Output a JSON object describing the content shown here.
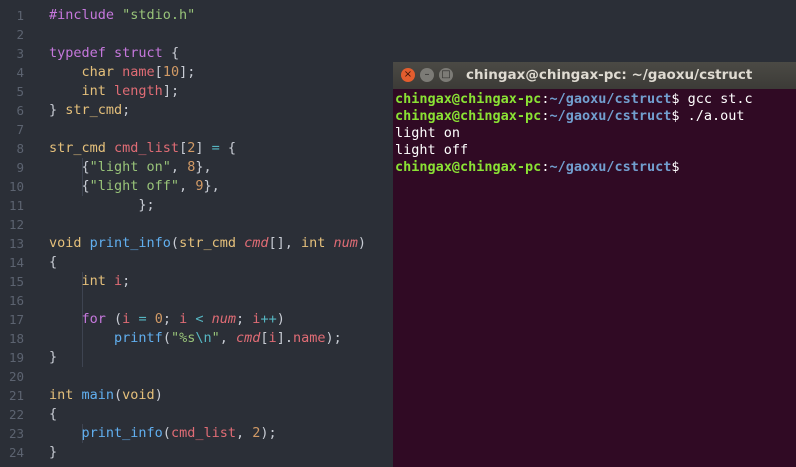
{
  "editor": {
    "lines": [
      {
        "n": "1",
        "t": [
          [
            "pp",
            "#include "
          ],
          [
            "st",
            "\"stdio.h\""
          ]
        ]
      },
      {
        "n": "2",
        "t": []
      },
      {
        "n": "3",
        "t": [
          [
            "kw",
            "typedef "
          ],
          [
            "kw",
            "struct "
          ],
          [
            "",
            "{"
          ]
        ]
      },
      {
        "n": "4",
        "t": [
          [
            "",
            "    "
          ],
          [
            "ty",
            "char "
          ],
          [
            "va",
            "name"
          ],
          [
            "",
            "["
          ],
          [
            "nu",
            "10"
          ],
          [
            "",
            "];"
          ]
        ]
      },
      {
        "n": "5",
        "t": [
          [
            "",
            "    "
          ],
          [
            "ty",
            "int "
          ],
          [
            "va",
            "length"
          ],
          [
            "",
            "];"
          ]
        ]
      },
      {
        "n": "6",
        "t": [
          [
            "",
            "} "
          ],
          [
            "ty",
            "str_cmd"
          ],
          [
            "",
            ";"
          ]
        ]
      },
      {
        "n": "7",
        "t": []
      },
      {
        "n": "8",
        "t": [
          [
            "ty",
            "str_cmd "
          ],
          [
            "va",
            "cmd_list"
          ],
          [
            "",
            "["
          ],
          [
            "nu",
            "2"
          ],
          [
            "",
            "] "
          ],
          [
            "op",
            "= "
          ],
          [
            "",
            "{"
          ]
        ]
      },
      {
        "n": "9",
        "t": [
          [
            "",
            "    {"
          ],
          [
            "st",
            "\"light on\""
          ],
          [
            "",
            ", "
          ],
          [
            "nu",
            "8"
          ],
          [
            "",
            "},"
          ]
        ]
      },
      {
        "n": "10",
        "t": [
          [
            "",
            "    {"
          ],
          [
            "st",
            "\"light off\""
          ],
          [
            "",
            ", "
          ],
          [
            "nu",
            "9"
          ],
          [
            "",
            "},"
          ]
        ]
      },
      {
        "n": "11",
        "t": [
          [
            "",
            "           };"
          ]
        ]
      },
      {
        "n": "12",
        "t": []
      },
      {
        "n": "13",
        "t": [
          [
            "ty",
            "void "
          ],
          [
            "fn",
            "print_info"
          ],
          [
            "",
            "("
          ],
          [
            "ty",
            "str_cmd "
          ],
          [
            "pa",
            "cmd"
          ],
          [
            "",
            "[], "
          ],
          [
            "ty",
            "int "
          ],
          [
            "pa",
            "num"
          ],
          [
            "",
            ")"
          ]
        ]
      },
      {
        "n": "14",
        "t": [
          [
            "",
            "{"
          ]
        ]
      },
      {
        "n": "15",
        "t": [
          [
            "",
            "    "
          ],
          [
            "ty",
            "int "
          ],
          [
            "va",
            "i"
          ],
          [
            "",
            ";"
          ]
        ]
      },
      {
        "n": "16",
        "t": []
      },
      {
        "n": "17",
        "t": [
          [
            "",
            "    "
          ],
          [
            "kw",
            "for "
          ],
          [
            "",
            "("
          ],
          [
            "va",
            "i "
          ],
          [
            "op",
            "= "
          ],
          [
            "nu",
            "0"
          ],
          [
            "",
            "; "
          ],
          [
            "va",
            "i "
          ],
          [
            "op",
            "< "
          ],
          [
            "pa",
            "num"
          ],
          [
            "",
            "; "
          ],
          [
            "va",
            "i"
          ],
          [
            "op",
            "++"
          ],
          [
            "",
            ")"
          ]
        ]
      },
      {
        "n": "18",
        "t": [
          [
            "",
            "        "
          ],
          [
            "fn",
            "printf"
          ],
          [
            "",
            "("
          ],
          [
            "st",
            "\"%s"
          ],
          [
            "op",
            "\\n"
          ],
          [
            "st",
            "\""
          ],
          [
            "",
            ", "
          ],
          [
            "pa",
            "cmd"
          ],
          [
            "",
            "["
          ],
          [
            "va",
            "i"
          ],
          [
            "",
            "]."
          ],
          [
            "va",
            "name"
          ],
          [
            "",
            ");"
          ]
        ]
      },
      {
        "n": "19",
        "t": [
          [
            "",
            "}"
          ]
        ]
      },
      {
        "n": "20",
        "t": []
      },
      {
        "n": "21",
        "t": [
          [
            "ty",
            "int "
          ],
          [
            "fn",
            "main"
          ],
          [
            "",
            "("
          ],
          [
            "ty",
            "void"
          ],
          [
            "",
            ")"
          ]
        ]
      },
      {
        "n": "22",
        "t": [
          [
            "",
            "{"
          ]
        ]
      },
      {
        "n": "23",
        "t": [
          [
            "",
            "    "
          ],
          [
            "fn",
            "print_info"
          ],
          [
            "",
            "("
          ],
          [
            "va",
            "cmd_list"
          ],
          [
            "",
            ", "
          ],
          [
            "nu",
            "2"
          ],
          [
            "",
            ");"
          ]
        ]
      },
      {
        "n": "24",
        "t": [
          [
            "",
            "}"
          ]
        ]
      }
    ]
  },
  "terminal": {
    "title": "chingax@chingax-pc: ~/gaoxu/cstruct",
    "buttons": {
      "close": "×",
      "minimize": "–",
      "maximize": "□"
    },
    "lines": [
      {
        "prompt": {
          "user": "chingax@chingax-pc",
          "sep": ":",
          "dir": "~/gaoxu/cstruct",
          "sym": "$"
        },
        "text": " gcc st.c"
      },
      {
        "prompt": {
          "user": "chingax@chingax-pc",
          "sep": ":",
          "dir": "~/gaoxu/cstruct",
          "sym": "$"
        },
        "text": " ./a.out"
      },
      {
        "text": "light on"
      },
      {
        "text": "light off"
      },
      {
        "prompt": {
          "user": "chingax@chingax-pc",
          "sep": ":",
          "dir": "~/gaoxu/cstruct",
          "sym": "$"
        },
        "text": ""
      }
    ]
  },
  "colors": {
    "editor_bg": "#2b2f37",
    "terminal_bg": "#300a24",
    "prompt_user": "#8ae234",
    "prompt_dir": "#729fcf"
  }
}
